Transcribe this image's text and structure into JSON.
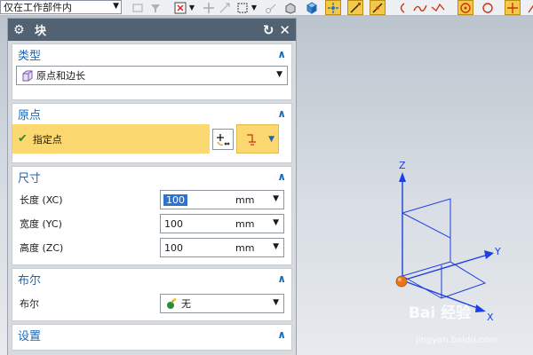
{
  "toolbar": {
    "filter_label": "仅在工作部件内"
  },
  "dialog": {
    "title": "块",
    "type_section": {
      "header": "类型",
      "value": "原点和边长"
    },
    "origin_section": {
      "header": "原点",
      "specify_point_label": "指定点"
    },
    "size_section": {
      "header": "尺寸",
      "rows": [
        {
          "label": "长度 (XC)",
          "value": "100",
          "unit": "mm"
        },
        {
          "label": "宽度 (YC)",
          "value": "100",
          "unit": "mm"
        },
        {
          "label": "高度 (ZC)",
          "value": "100",
          "unit": "mm"
        }
      ]
    },
    "boolean_section": {
      "header": "布尔",
      "label": "布尔",
      "value": "无"
    },
    "settings_section": {
      "header": "设置"
    }
  },
  "viewport": {
    "axis_x": "X",
    "axis_y": "Y",
    "axis_z": "Z",
    "accent_color": "#1d3fe0",
    "origin_color": "#e5761c"
  },
  "watermark": {
    "main": "Bai 经验",
    "sub": "jingyan.baidu.com"
  }
}
